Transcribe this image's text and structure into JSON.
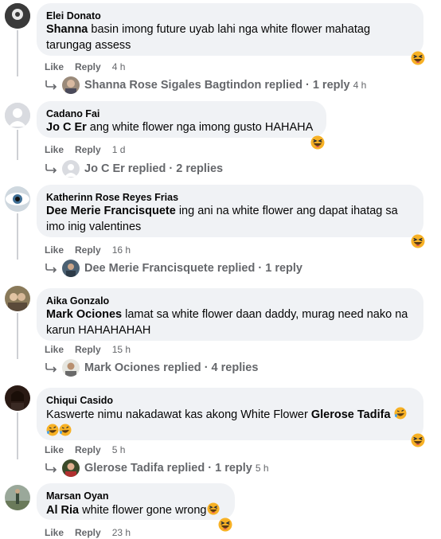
{
  "colors": {
    "bubble": "#f0f2f5",
    "meta": "#65676b",
    "text": "#050505"
  },
  "comments": [
    {
      "author": "Elei Donato",
      "mention": "Shanna",
      "text": "basin imong future uyab lahi nga white flower mahatag tarungag assess",
      "like": "Like",
      "reply": "Reply",
      "time": "4 h",
      "reaction_icon": "laughing-emoji-icon",
      "replies": {
        "name": "Shanna Rose Sigales Bagtindon replied",
        "count": "· 1 reply",
        "time": "4 h"
      }
    },
    {
      "author": "Cadano Fai",
      "mention": "Jo C Er",
      "text": "ang white flower nga imong gusto HAHAHA",
      "like": "Like",
      "reply": "Reply",
      "time": "1 d",
      "reaction_icon": "laughing-emoji-icon",
      "replies": {
        "name": "Jo C Er replied",
        "count": "· 2 replies",
        "time": ""
      }
    },
    {
      "author": "Katherinn Rose Reyes Frias",
      "mention": "Dee Merie Francisquete",
      "text": "ing ani na white flower ang dapat ihatag sa imo inig valentines",
      "like": "Like",
      "reply": "Reply",
      "time": "16 h",
      "reaction_icon": "laughing-emoji-icon",
      "replies": {
        "name": "Dee Merie Francisquete replied",
        "count": "· 1 reply",
        "time": ""
      }
    },
    {
      "author": "Aika Gonzalo",
      "mention": "Mark Ociones",
      "text": "lamat sa white flower daan daddy, murag need nako na karun HAHAHAHAH",
      "like": "Like",
      "reply": "Reply",
      "time": "15 h",
      "reaction_icon": "",
      "replies": {
        "name": "Mark Ociones replied",
        "count": "· 4 replies",
        "time": ""
      }
    },
    {
      "author": "Chiqui Casido",
      "mention": "Glerose Tadifa",
      "text_before": "Kaswerte nimu nakadawat kas akong White Flower",
      "like": "Like",
      "reply": "Reply",
      "time": "5 h",
      "reaction_icon": "laughing-emoji-icon",
      "replies": {
        "name": "Glerose Tadifa replied",
        "count": "· 1 reply",
        "time": "5 h"
      }
    },
    {
      "author": "Marsan Oyan",
      "mention": "Al Ria",
      "text": "white flower gone wrong",
      "like": "Like",
      "reply": "Reply",
      "time": "23 h",
      "reaction_icon": "laughing-emoji-icon"
    }
  ]
}
